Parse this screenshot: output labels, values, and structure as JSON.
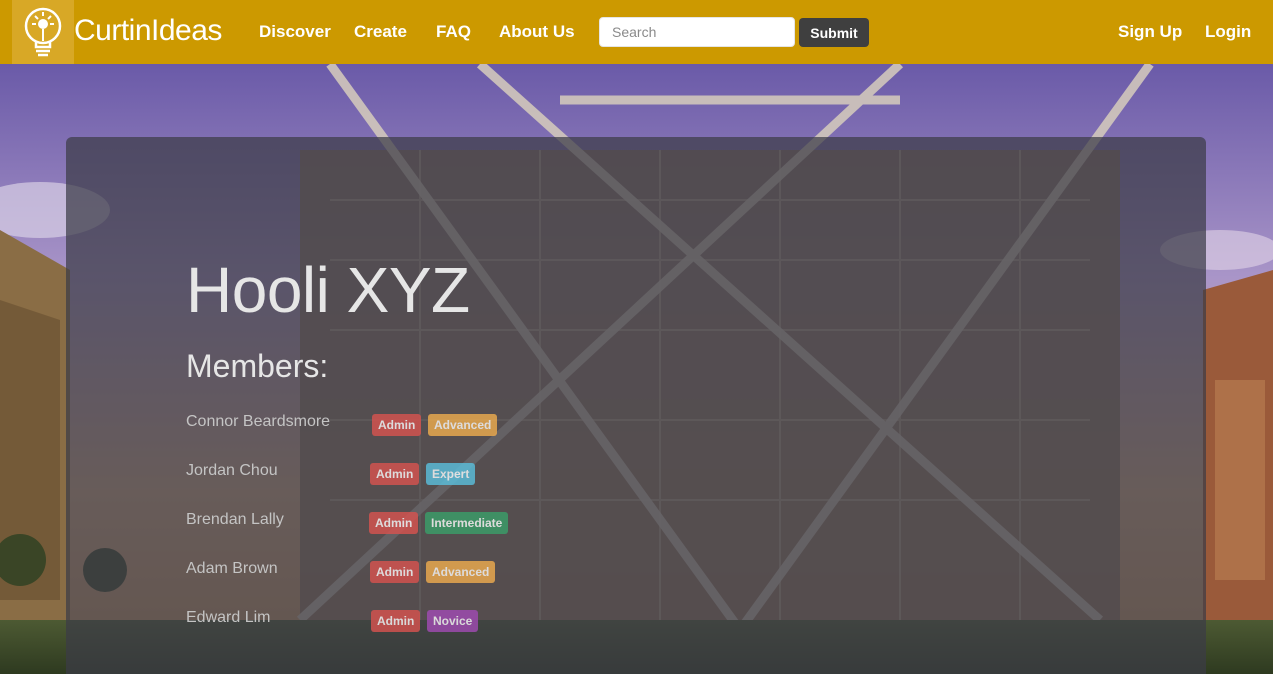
{
  "navbar": {
    "brand": "CurtinIdeas",
    "links": [
      "Discover",
      "Create",
      "FAQ",
      "About Us"
    ],
    "search": {
      "placeholder": "Search",
      "value": ""
    },
    "submit_label": "Submit",
    "signup_label": "Sign Up",
    "login_label": "Login",
    "logo_icon": "lightbulb-icon"
  },
  "main": {
    "title": "Hooli XYZ",
    "members_heading": "Members:",
    "members": [
      {
        "name": "Connor Beardsmore",
        "role": "Admin",
        "level": "Advanced"
      },
      {
        "name": "Jordan Chou",
        "role": "Admin",
        "level": "Expert"
      },
      {
        "name": "Brendan Lally",
        "role": "Admin",
        "level": "Intermediate"
      },
      {
        "name": "Adam Brown",
        "role": "Admin",
        "level": "Advanced"
      },
      {
        "name": "Edward Lim",
        "role": "Admin",
        "level": "Novice"
      }
    ]
  },
  "colors": {
    "navbar": "#cc9900",
    "admin": "#d9534f",
    "advanced": "#f0ad4e",
    "expert": "#5bc0de",
    "intermediate": "#3aa06a",
    "novice": "#a24bb5"
  }
}
